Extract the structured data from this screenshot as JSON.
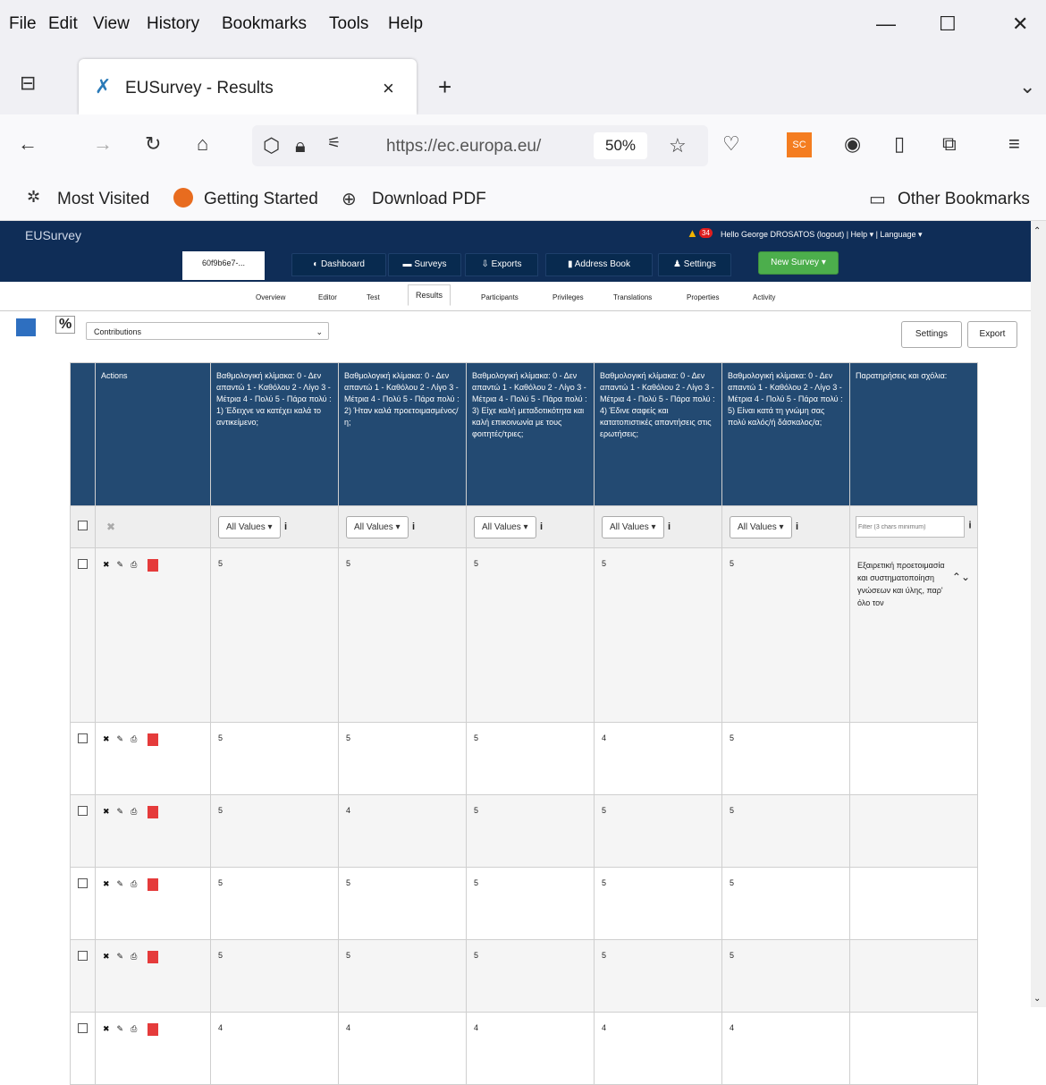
{
  "menubar": {
    "items": [
      "File",
      "Edit",
      "View",
      "History",
      "Bookmarks",
      "Tools",
      "Help"
    ],
    "minimize": "—",
    "maximize": "☐",
    "close": "✕"
  },
  "tab": {
    "title": "EUSurvey - Results",
    "close": "×",
    "new": "+"
  },
  "toolbar": {
    "url": "https://ec.europa.eu/",
    "zoom": "50%"
  },
  "bookmarks": {
    "most_visited": "Most Visited",
    "getting_started": "Getting Started",
    "download_pdf": "Download PDF",
    "other": "Other Bookmarks"
  },
  "app": {
    "logo": "EUSurvey",
    "notifications": "34",
    "user_line": "Hello George DROSATOS (logout) | Help ▾ | Language ▾",
    "survey_tab": "60f9b6e7-...",
    "nav": {
      "dashboard": "Dashboard",
      "surveys": "Surveys",
      "exports": "Exports",
      "address_book": "Address Book",
      "settings": "Settings",
      "new_survey": "New Survey ▾"
    },
    "subnav": [
      "Overview",
      "Editor",
      "Test",
      "Results",
      "Participants",
      "Privileges",
      "Translations",
      "Properties",
      "Activity"
    ],
    "view_select": "Contributions",
    "settings_btn": "Settings",
    "export_btn": "Export"
  },
  "table": {
    "headers": [
      "Actions",
      "Βαθμολογική κλίμακα: 0 - Δεν απαντώ 1 - Καθόλου 2 - Λίγο 3 - Μέτρια 4 - Πολύ 5 - Πάρα πολύ : 1) Έδειχνε να κατέχει καλά το αντικείμενο;",
      "Βαθμολογική κλίμακα: 0 - Δεν απαντώ 1 - Καθόλου 2 - Λίγο 3 - Μέτρια 4 - Πολύ 5 - Πάρα πολύ : 2) Ήταν καλά προετοιμασμένος/η;",
      "Βαθμολογική κλίμακα: 0 - Δεν απαντώ 1 - Καθόλου 2 - Λίγο 3 - Μέτρια 4 - Πολύ 5 - Πάρα πολύ : 3) Είχε καλή μεταδοτικότητα και καλή επικοινωνία με τους φοιτητές/τριες;",
      "Βαθμολογική κλίμακα: 0 - Δεν απαντώ 1 - Καθόλου 2 - Λίγο 3 - Μέτρια 4 - Πολύ 5 - Πάρα πολύ : 4) Έδινε σαφείς και κατατοπιστικές απαντήσεις στις ερωτήσεις;",
      "Βαθμολογική κλίμακα: 0 - Δεν απαντώ 1 - Καθόλου 2 - Λίγο 3 - Μέτρια 4 - Πολύ 5 - Πάρα πολύ : 5) Είναι κατά τη γνώμη σας πολύ καλός/ή δάσκαλος/α;",
      "Παρατηρήσεις και σχόλια:"
    ],
    "filter_label": "All Values ▾",
    "text_filter_placeholder": "Filter (3 chars minimum)",
    "rows": [
      {
        "v": [
          "5",
          "5",
          "5",
          "5",
          "5"
        ],
        "comment": "Εξαιρετική προετοιμασία και συστηματοποίηση γνώσεων και ύλης, παρ' όλο τον"
      },
      {
        "v": [
          "5",
          "5",
          "5",
          "4",
          "5"
        ],
        "comment": ""
      },
      {
        "v": [
          "5",
          "4",
          "5",
          "5",
          "5"
        ],
        "comment": ""
      },
      {
        "v": [
          "5",
          "5",
          "5",
          "5",
          "5"
        ],
        "comment": ""
      },
      {
        "v": [
          "5",
          "5",
          "5",
          "5",
          "5"
        ],
        "comment": ""
      },
      {
        "v": [
          "4",
          "4",
          "4",
          "4",
          "4"
        ],
        "comment": ""
      }
    ]
  }
}
